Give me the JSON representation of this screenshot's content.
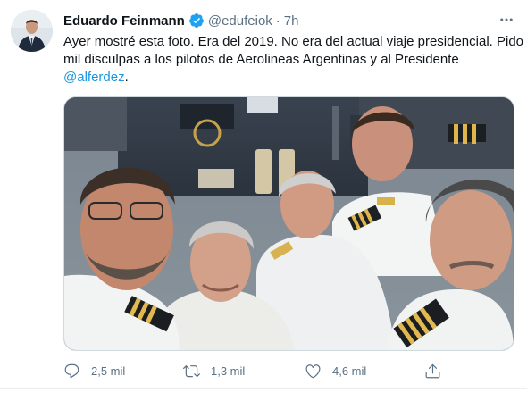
{
  "tweet": {
    "author": {
      "display_name": "Eduardo Feinmann",
      "handle": "@edufeiok",
      "verified": true,
      "avatar": "profile-photo"
    },
    "separator": "·",
    "time": "7h",
    "text": {
      "line1": "Ayer mostré esta foto. Era del 2019. No era del actual viaje presidencial. Pido",
      "line2": "mil disculpas a los pilotos de Aerolineas Argentinas y al Presidente",
      "mention": "@alferdez",
      "trailing": "."
    },
    "media": {
      "type": "photo",
      "description_icon": "cockpit-selfie-photo"
    },
    "actions": {
      "reply": {
        "icon": "reply-icon",
        "count": "2,5 mil"
      },
      "retweet": {
        "icon": "retweet-icon",
        "count": "1,3 mil"
      },
      "like": {
        "icon": "heart-icon",
        "count": "4,6 mil"
      },
      "share": {
        "icon": "share-icon"
      }
    },
    "more_icon": "more-icon"
  },
  "colors": {
    "accent": "#1da1f2",
    "mention": "#1b95e0",
    "secondary_text": "#5b7083",
    "border": "#ebeef0"
  }
}
